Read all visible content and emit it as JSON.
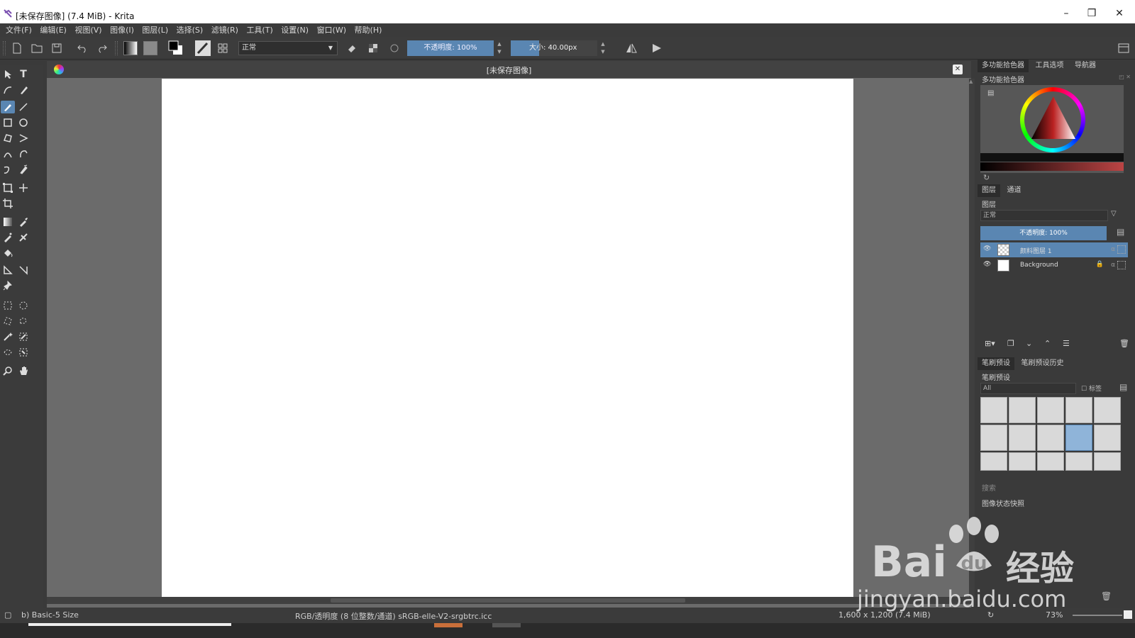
{
  "window": {
    "title": "[未保存图像]  (7.4 MiB)  - Krita",
    "minimize": "–",
    "maximize": "❒",
    "close": "✕"
  },
  "menu": [
    "文件(F)",
    "编辑(E)",
    "视图(V)",
    "图像(I)",
    "图层(L)",
    "选择(S)",
    "滤镜(R)",
    "工具(T)",
    "设置(N)",
    "窗口(W)",
    "帮助(H)"
  ],
  "toolbar": {
    "blend_mode": "正常",
    "opacity_label": "不透明度:  100%",
    "size_label": "大小:  40.00px",
    "size_fraction": 0.33
  },
  "document": {
    "tab_title": "[未保存图像]",
    "close": "✕"
  },
  "dock": {
    "top_tabs": [
      "多功能拾色器",
      "工具选项",
      "导航器"
    ],
    "color_selector_title": "多功能拾色器",
    "layer_tabs": [
      "图层",
      "通道"
    ],
    "layers_title": "图层",
    "layer_blend": "正常",
    "layer_opacity": "不透明度:  100%",
    "layers": [
      {
        "name": "颜料图层  1",
        "active": true
      },
      {
        "name": "Background",
        "active": false
      }
    ],
    "brush_tabs": [
      "笔刷预设",
      "笔刷预设历史"
    ],
    "brush_title": "笔刷预设",
    "brush_filter": "All",
    "brush_tag": "标签",
    "search_label": "搜索",
    "snapshot_title": "图像状态快照"
  },
  "status": {
    "brush": "b) Basic-5 Size",
    "color_space": "RGB/透明度 (8 位整数/通道)  sRGB-elle-V2-srgbtrc.icc",
    "image_size": "1,600 x 1,200 (7.4 MiB)",
    "zoom": "73%"
  },
  "watermark": {
    "brand": "Bai",
    "brand2": "经验",
    "url": "jingyan.baidu.com"
  }
}
